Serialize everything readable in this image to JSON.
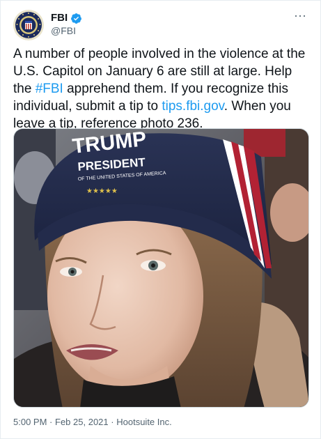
{
  "account": {
    "name": "FBI",
    "handle": "@FBI",
    "verified": true,
    "avatar_icon": "fbi-seal-icon"
  },
  "tweet": {
    "text_1": "A number of people involved in the violence at the U.S. Capitol on January 6 are still at large. Help the ",
    "hashtag": "#FBI",
    "text_2": " apprehend them. If you recognize this individual, submit a tip to ",
    "link": "tips.fbi.gov",
    "text_3": ". When you leave a tip, reference photo 236."
  },
  "media": {
    "hat_text_1": "TRUMP",
    "hat_text_2": "PRESIDENT",
    "hat_text_3": "OF THE UNITED STATES OF AMERICA"
  },
  "meta": {
    "time": "5:00 PM",
    "separator": "·",
    "date": "Feb 25, 2021",
    "source": "Hootsuite Inc."
  },
  "colors": {
    "link": "#1d9bf0",
    "verified": "#1d9bf0",
    "secondary_text": "#536471"
  },
  "icons": {
    "more": "more-options-icon",
    "verified": "verified-badge-icon"
  }
}
